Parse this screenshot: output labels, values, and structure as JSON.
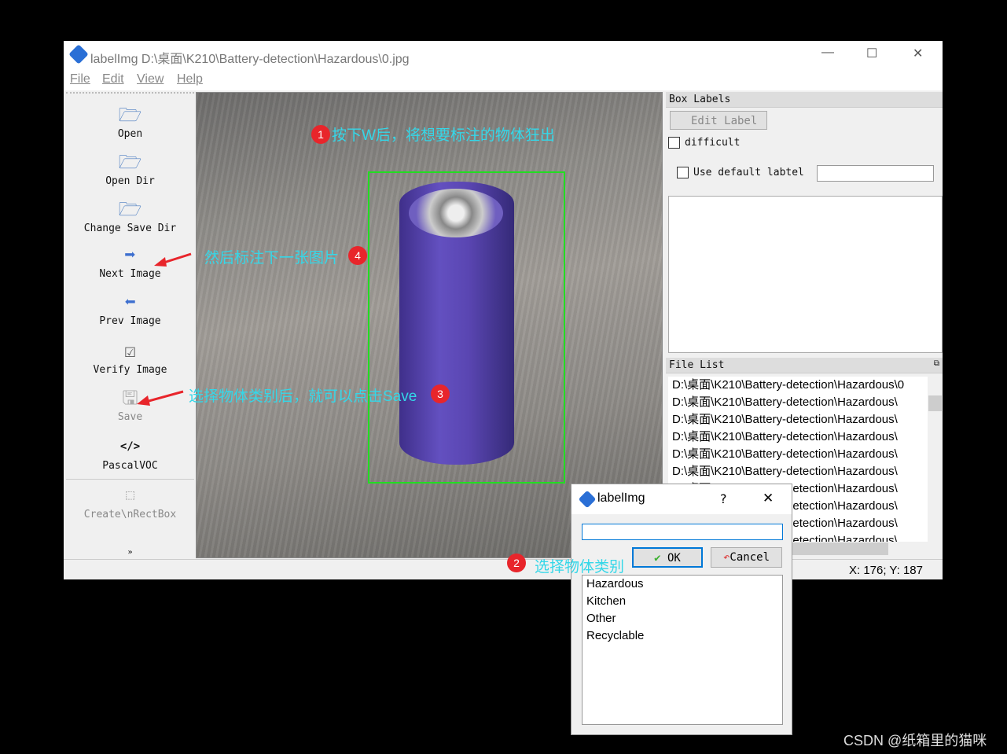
{
  "window": {
    "title": "labelImg D:\\桌面\\K210\\Battery-detection\\Hazardous\\0.jpg",
    "controls": {
      "minimize": "—",
      "maximize": "☐",
      "close": "✕"
    }
  },
  "menu": [
    "File",
    "Edit",
    "View",
    "Help"
  ],
  "toolbar": [
    {
      "label": "Open",
      "icon": "folder-open-icon",
      "enabled": true
    },
    {
      "label": "Open Dir",
      "icon": "folder-open-icon",
      "enabled": true
    },
    {
      "label": "Change Save Dir",
      "icon": "folder-open-icon",
      "enabled": true
    },
    {
      "label": "Next Image",
      "icon": "arrow-right-icon",
      "enabled": true
    },
    {
      "label": "Prev Image",
      "icon": "arrow-left-icon",
      "enabled": true
    },
    {
      "label": "Verify Image",
      "icon": "checkbox-icon",
      "enabled": true
    },
    {
      "label": "Save",
      "icon": "save-icon",
      "enabled": false
    },
    {
      "label": "PascalVOC",
      "icon": "code-icon",
      "enabled": true
    },
    {
      "label": "Create\\nRectBox",
      "icon": "rectbox-icon",
      "enabled": false
    }
  ],
  "more_chevron": "»",
  "box_labels": {
    "header": "Box Labels",
    "edit_label": "Edit Label",
    "difficult": "difficult",
    "difficult_checked": false,
    "use_default": "Use default labtel",
    "use_default_checked": false,
    "default_value": ""
  },
  "file_list": {
    "header": "File List",
    "items": [
      "D:\\桌面\\K210\\Battery-detection\\Hazardous\\0",
      "D:\\桌面\\K210\\Battery-detection\\Hazardous\\",
      "D:\\桌面\\K210\\Battery-detection\\Hazardous\\",
      "D:\\桌面\\K210\\Battery-detection\\Hazardous\\",
      "D:\\桌面\\K210\\Battery-detection\\Hazardous\\",
      "D:\\桌面\\K210\\Battery-detection\\Hazardous\\",
      "D:\\桌面\\K210\\Battery-detection\\Hazardous\\",
      "D:\\桌面\\K210\\Battery-detection\\Hazardous\\",
      "D:\\桌面\\K210\\Battery-detection\\Hazardous\\",
      "D:\\桌面\\K210\\Battery-detection\\Hazardous\\"
    ]
  },
  "status": {
    "coords": "X: 176; Y: 187"
  },
  "dialog": {
    "title": "labelImg",
    "help": "?",
    "close": "✕",
    "input_value": "",
    "ok": "OK",
    "cancel": "Cancel",
    "options": [
      "Hazardous",
      "Kitchen",
      "Other",
      "Recyclable"
    ]
  },
  "annotations": [
    {
      "num": "1",
      "text": "按下W后，将想要标注的物体狂出"
    },
    {
      "num": "2",
      "text": "选择物体类别"
    },
    {
      "num": "3",
      "text": "选择物体类别后，就可以点击Save"
    },
    {
      "num": "4",
      "text": "然后标注下一张图片"
    }
  ],
  "colors": {
    "bbox": "#22dd22",
    "annotation_text": "#34d7e8",
    "badge": "#e8252b",
    "battery": "#5a45b0"
  },
  "watermark": "CSDN @纸箱里的猫咪"
}
